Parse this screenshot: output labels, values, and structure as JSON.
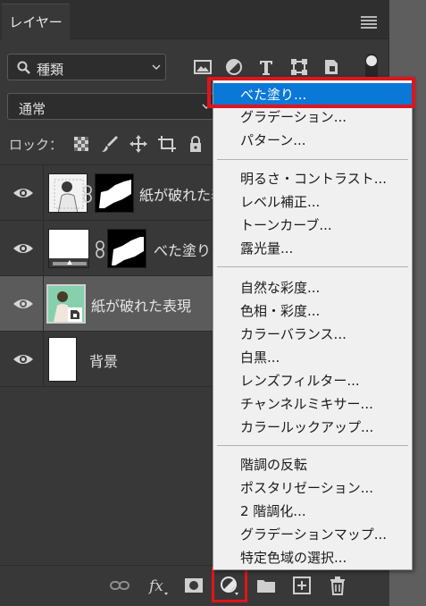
{
  "tab": {
    "label": "レイヤー"
  },
  "filter": {
    "label": "種類"
  },
  "blend": {
    "label": "通常"
  },
  "lock": {
    "label": "ロック："
  },
  "layers": [
    {
      "name": "紙が破れた表現",
      "visible": true,
      "selected": false,
      "has_mask": true
    },
    {
      "name": "べた塗り",
      "visible": true,
      "selected": false,
      "has_mask": true
    },
    {
      "name": "紙が破れた表現",
      "visible": true,
      "selected": true,
      "has_mask": false
    },
    {
      "name": "背景",
      "visible": true,
      "selected": false,
      "has_mask": false
    }
  ],
  "menu": {
    "groups": [
      [
        "べた塗り...",
        "グラデーション...",
        "パターン..."
      ],
      [
        "明るさ・コントラスト...",
        "レベル補正...",
        "トーンカーブ...",
        "露光量..."
      ],
      [
        "自然な彩度...",
        "色相・彩度...",
        "カラーバランス...",
        "白黒...",
        "レンズフィルター...",
        "チャンネルミキサー...",
        "カラールックアップ..."
      ],
      [
        "階調の反転",
        "ポスタリゼーション...",
        "2 階調化...",
        "グラデーションマップ...",
        "特定色域の選択..."
      ]
    ],
    "highlighted": "べた塗り..."
  },
  "colors": {
    "highlight": "#0a78d7",
    "annotation_red": "#e0141c",
    "panel_bg": "#383838"
  }
}
